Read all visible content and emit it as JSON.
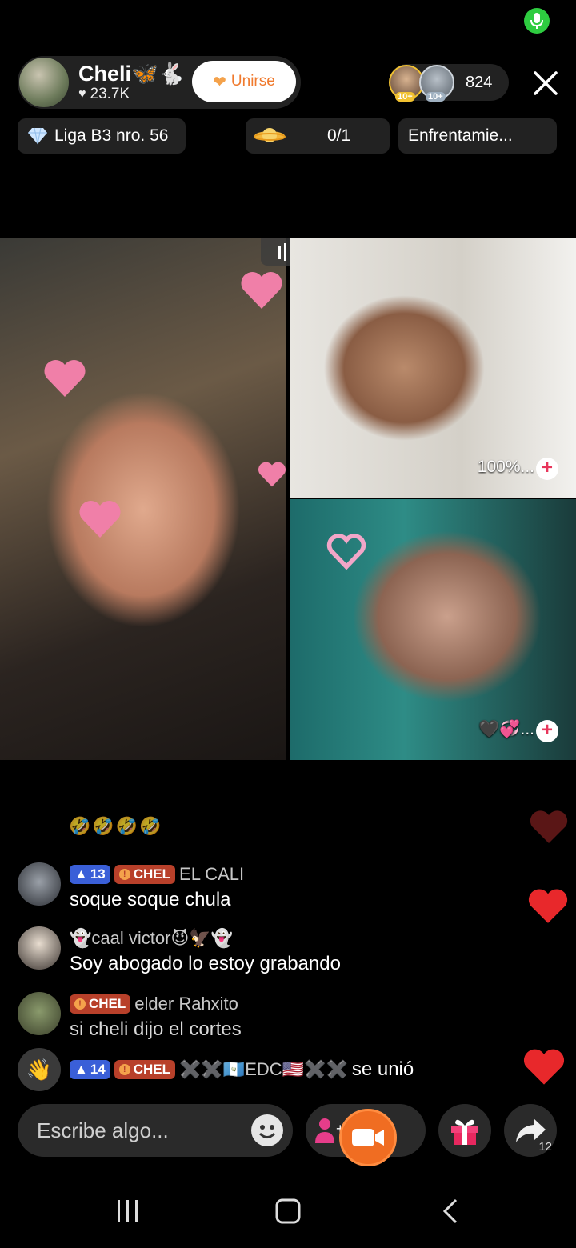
{
  "host": {
    "name": "Cheli🦋🐇",
    "likes": "23.7K",
    "join_label": "Unirse"
  },
  "viewers": {
    "badge_1": "10+",
    "badge_2": "10+",
    "count": "824"
  },
  "chips": {
    "league": "Liga B3 nro. 56",
    "goal": "0/1",
    "versus": "Enfrentamie..."
  },
  "tiles": {
    "top_right_label": "100%...",
    "bottom_right_label": "🖤💞..."
  },
  "chat": {
    "partial_emojis": "🤣🤣🤣🤣",
    "messages": [
      {
        "level": "13",
        "team": "CHEL",
        "user": "EL CALI",
        "text": "soque soque chula"
      },
      {
        "user": "👻caal victor😈🦅👻",
        "text": "Soy abogado lo estoy grabando"
      },
      {
        "team": "CHEL",
        "user": "elder Rahxito",
        "text": "si cheli dijo el cortes"
      }
    ],
    "join_notice": {
      "level": "14",
      "team": "CHEL",
      "user": "✖️✖️🇬🇹EDC🇺🇸✖️✖️",
      "action": "se unió"
    }
  },
  "bottom": {
    "input_placeholder": "Escribe algo...",
    "share_count": "12"
  },
  "colors": {
    "accent_orange": "#f06d22",
    "heart_red": "#e8282b",
    "level_blue": "#3a5fd8",
    "team_red": "#b8402a",
    "mic_green": "#2ecc40"
  },
  "icons": [
    "mic-icon",
    "close-icon",
    "diamond-icon",
    "planet-icon",
    "sound-bars-icon",
    "plus-icon",
    "heart-icon",
    "wave-hand-icon",
    "emoji-icon",
    "guests-icon",
    "camera-icon",
    "gift-icon",
    "share-icon",
    "recents-icon",
    "home-icon",
    "back-icon"
  ]
}
